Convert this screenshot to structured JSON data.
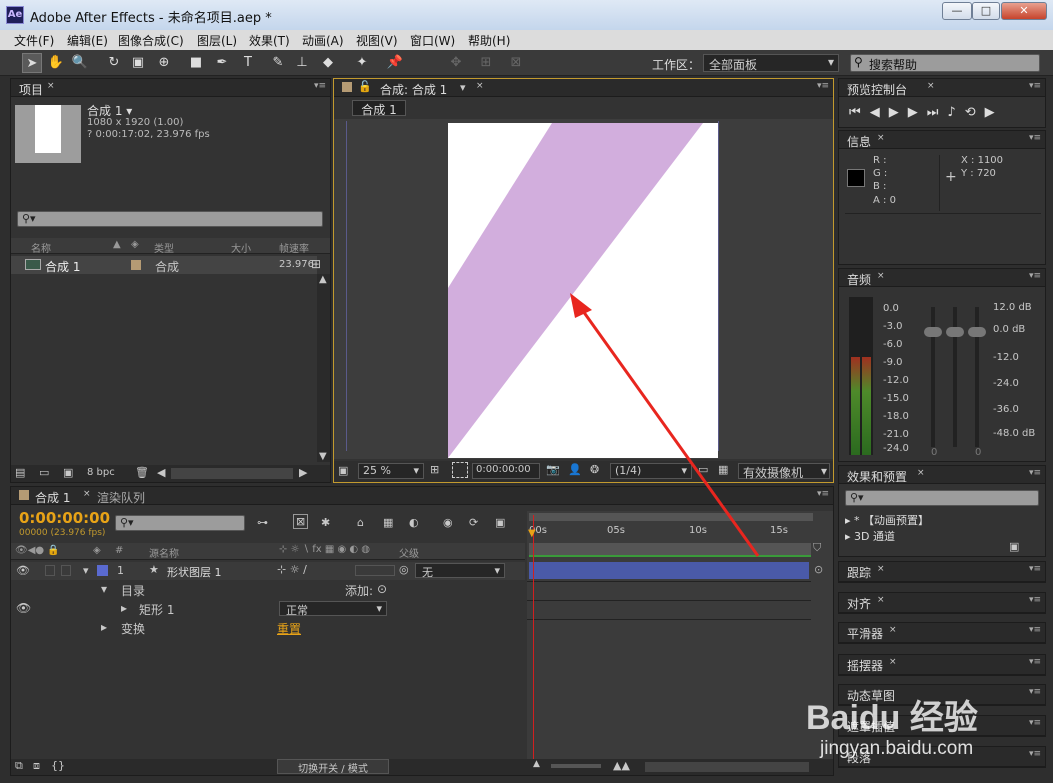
{
  "window": {
    "app_logo": "Ae",
    "title": "Adobe After Effects - 未命名项目.aep *",
    "min": "—",
    "max": "□",
    "close": "✕"
  },
  "menu": [
    "文件(F)",
    "编辑(E)",
    "图像合成(C)",
    "图层(L)",
    "效果(T)",
    "动画(A)",
    "视图(V)",
    "窗口(W)",
    "帮助(H)"
  ],
  "toolbar": {
    "workspace_label": "工作区：",
    "workspace_value": "全部面板",
    "search_help": "搜索帮助"
  },
  "project": {
    "tab": "项目",
    "comp_name": "合成 1 ▾",
    "comp_size": "1080 x 1920 (1.00)",
    "comp_duration": "? 0:00:17:02, 23.976 fps",
    "search_placeholder": "",
    "columns": {
      "name": "名称",
      "type": "类型",
      "size": "大小",
      "fps": "帧速率"
    },
    "rows": [
      {
        "name": "合成 1",
        "type": "合成",
        "size": "",
        "fps": "23.976"
      }
    ],
    "bpc": "8 bpc"
  },
  "composition": {
    "tab": "合成: 合成 1",
    "subtab": "合成 1",
    "zoom": "25 %",
    "timecode": "0:00:00:00",
    "resolution": "(1/4)",
    "camera": "有效摄像机",
    "stripe_color": "#d2aedd"
  },
  "preview": {
    "tab": "预览控制台"
  },
  "info": {
    "tab": "信息",
    "r": "R :",
    "g": "G :",
    "b": "B :",
    "a": "A : 0",
    "x": "X : 1100",
    "y": "Y : 720"
  },
  "audio": {
    "tab": "音频",
    "left_scale": [
      "0.0",
      "-3.0",
      "-6.0",
      "-9.0",
      "-12.0",
      "-15.0",
      "-18.0",
      "-21.0",
      "-24.0"
    ],
    "right_scale": [
      "12.0 dB",
      "0.0 dB",
      "-12.0",
      "-24.0",
      "-36.0",
      "-48.0 dB"
    ],
    "slider_zero": "0",
    "meter_level": 0.62
  },
  "effects": {
    "tab": "效果和预置",
    "items": [
      "* 【动画预置】",
      "3D 通道"
    ]
  },
  "side_panels": [
    "跟踪",
    "对齐",
    "平滑器",
    "摇摆器",
    "动态草图",
    "遮罩插值",
    "段落"
  ],
  "timeline": {
    "tab": "合成 1",
    "tab2": "渲染队列",
    "timecode": "0:00:00:00",
    "frames": "00000 (23.976 fps)",
    "col_source": "源名称",
    "col_parent": "父级",
    "col_num": "#",
    "layer": {
      "num": "1",
      "star": "★",
      "name": "形状图层 1",
      "parent": "无"
    },
    "contents": "目录",
    "add": "添加:",
    "rect": "矩形 1",
    "blend": "正常",
    "transform": "变换",
    "reset": "重置",
    "ruler": [
      "00s",
      "05s",
      "10s",
      "15s"
    ],
    "footer": "切换开关 / 模式",
    "layer_color": "#4a5aa8"
  },
  "watermark": {
    "brand": "Baidu 经验",
    "url": "jingyan.baidu.com"
  }
}
